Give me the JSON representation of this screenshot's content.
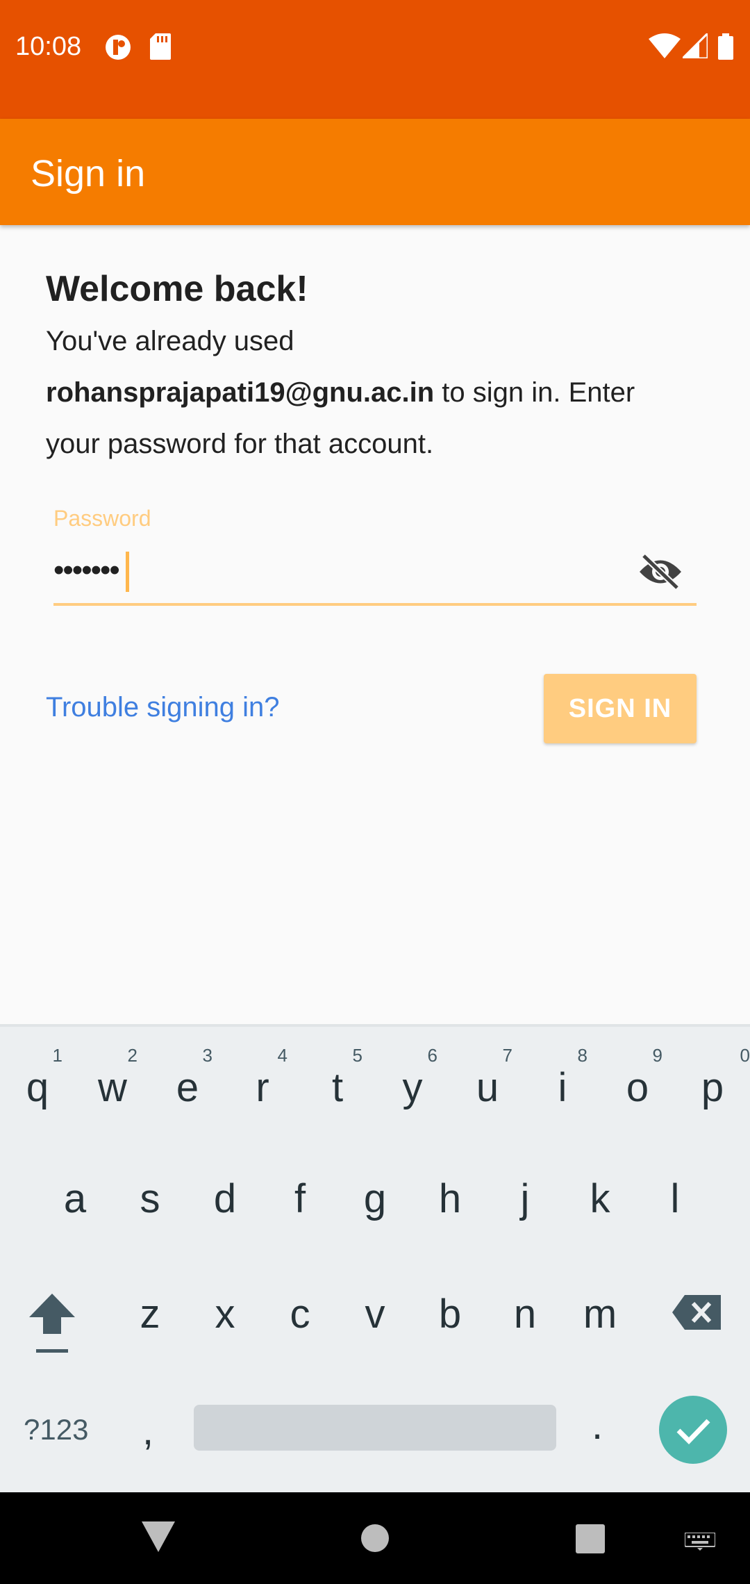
{
  "status_bar": {
    "time": "10:08",
    "icons": [
      "app-notification-icon",
      "sd-card-icon",
      "wifi-icon",
      "signal-icon",
      "battery-icon"
    ]
  },
  "app_bar": {
    "title": "Sign in"
  },
  "welcome": {
    "heading": "Welcome back!",
    "message_prefix": "You've already used ",
    "email": "rohansprajapati19@gnu.ac.in",
    "message_suffix": " to sign in. Enter your password for that account."
  },
  "password": {
    "label": "Password",
    "value": "•••••••"
  },
  "actions": {
    "trouble_link": "Trouble signing in?",
    "sign_in_button": "SIGN IN"
  },
  "keyboard": {
    "row1": [
      {
        "k": "q",
        "h": "1"
      },
      {
        "k": "w",
        "h": "2"
      },
      {
        "k": "e",
        "h": "3"
      },
      {
        "k": "r",
        "h": "4"
      },
      {
        "k": "t",
        "h": "5"
      },
      {
        "k": "y",
        "h": "6"
      },
      {
        "k": "u",
        "h": "7"
      },
      {
        "k": "i",
        "h": "8"
      },
      {
        "k": "o",
        "h": "9"
      },
      {
        "k": "p",
        "h": "0"
      }
    ],
    "row2": [
      "a",
      "s",
      "d",
      "f",
      "g",
      "h",
      "j",
      "k",
      "l"
    ],
    "row3": [
      "z",
      "x",
      "c",
      "v",
      "b",
      "n",
      "m"
    ],
    "symbols_key": "?123",
    "comma_key": ",",
    "period_key": "."
  },
  "colors": {
    "status_bar": "#E65100",
    "app_bar": "#F57C00",
    "accent_light": "#FFCC80",
    "link": "#3F7FE0",
    "enter_key": "#4DB6AC"
  }
}
